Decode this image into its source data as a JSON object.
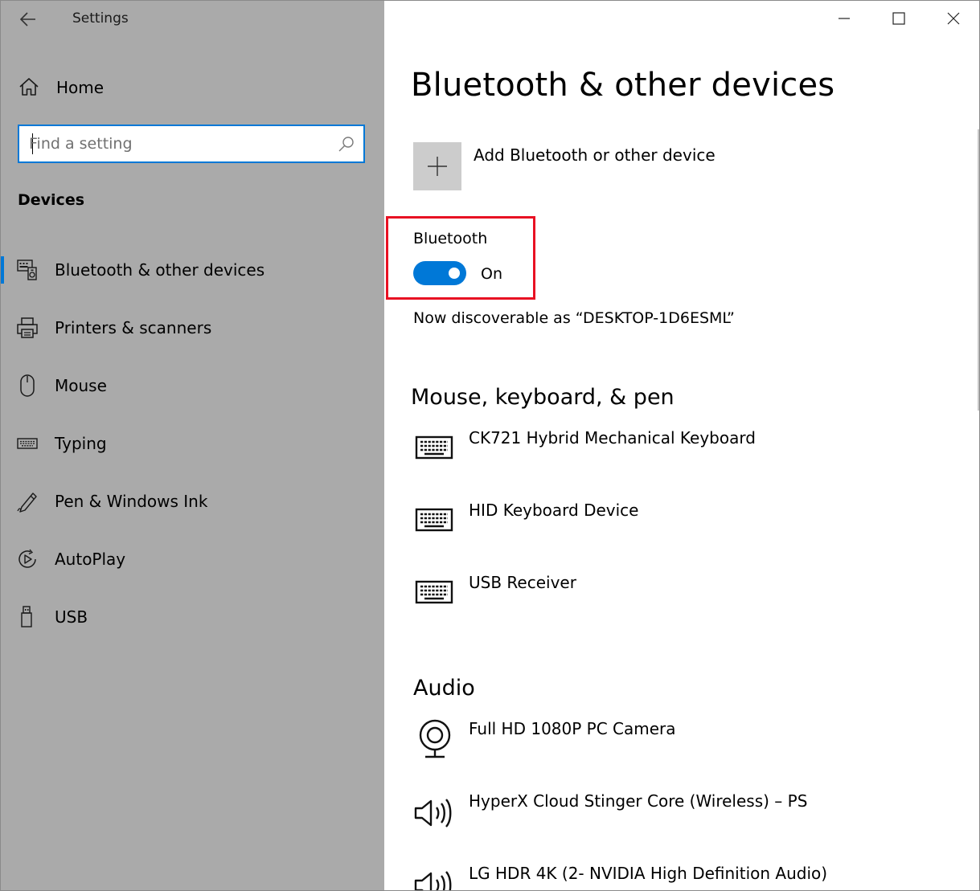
{
  "window": {
    "title": "Settings",
    "minimize_glyph": "minimize-icon",
    "maximize_glyph": "maximize-icon",
    "close_glyph": "close-icon"
  },
  "sidebar": {
    "home_label": "Home",
    "search_placeholder": "Find a setting",
    "section_title": "Devices",
    "items": [
      {
        "label": "Bluetooth & other devices",
        "icon": "bluetooth-devices-icon",
        "selected": true
      },
      {
        "label": "Printers & scanners",
        "icon": "printer-icon",
        "selected": false
      },
      {
        "label": "Mouse",
        "icon": "mouse-icon",
        "selected": false
      },
      {
        "label": "Typing",
        "icon": "keyboard-icon",
        "selected": false
      },
      {
        "label": "Pen & Windows Ink",
        "icon": "pen-icon",
        "selected": false
      },
      {
        "label": "AutoPlay",
        "icon": "autoplay-icon",
        "selected": false
      },
      {
        "label": "USB",
        "icon": "usb-icon",
        "selected": false
      }
    ]
  },
  "main": {
    "page_title": "Bluetooth & other devices",
    "add_device_label": "Add Bluetooth or other device",
    "bluetooth": {
      "label": "Bluetooth",
      "state": "On",
      "enabled": true,
      "discoverable_text": "Now discoverable as “DESKTOP-1D6ESML”"
    },
    "groups": [
      {
        "title": "Mouse, keyboard, & pen",
        "devices": [
          {
            "name": "CK721 Hybrid Mechanical Keyboard",
            "icon": "keyboard-icon"
          },
          {
            "name": "HID Keyboard Device",
            "icon": "keyboard-icon"
          },
          {
            "name": "USB Receiver",
            "icon": "keyboard-icon"
          }
        ]
      },
      {
        "title": "Audio",
        "devices": [
          {
            "name": "Full HD 1080P PC Camera",
            "icon": "webcam-icon"
          },
          {
            "name": "HyperX Cloud Stinger Core (Wireless) – PS",
            "icon": "speaker-icon"
          },
          {
            "name": "LG HDR 4K (2- NVIDIA High Definition Audio)",
            "icon": "speaker-icon"
          }
        ]
      }
    ]
  },
  "colors": {
    "sidebar_bg": "#aaaaaa",
    "accent": "#0078d7",
    "highlight_box": "#e81123",
    "add_tile_bg": "#cccccc"
  }
}
